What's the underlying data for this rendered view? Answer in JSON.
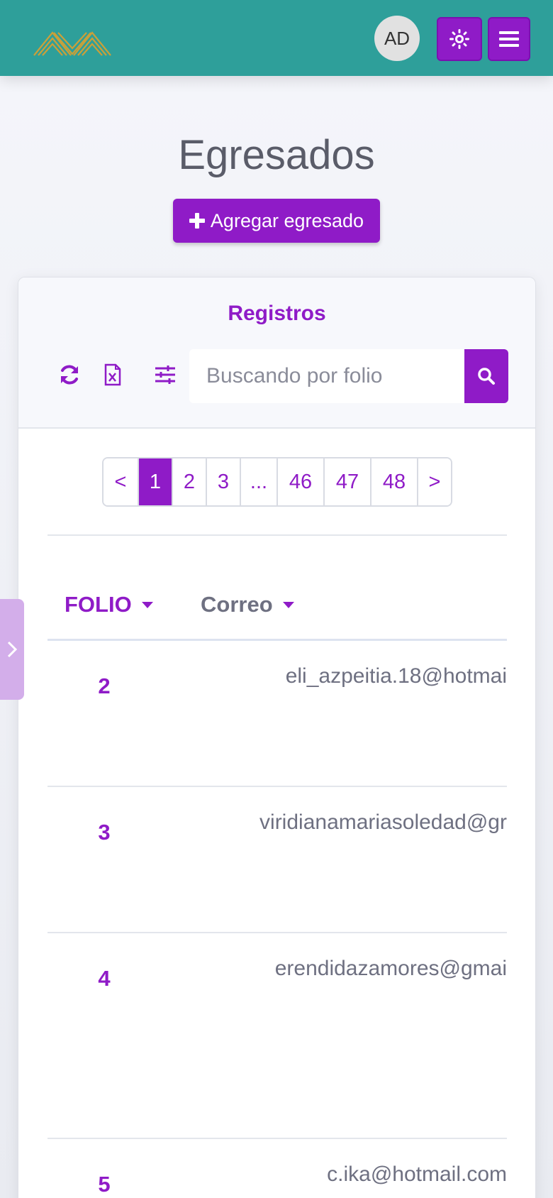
{
  "header": {
    "avatar_initials": "AD",
    "brand_color": "#2e9f9a",
    "accent_color": "#8f1bc7",
    "theme_icon": "sun-icon",
    "menu_icon": "hamburger-icon"
  },
  "page": {
    "title": "Egresados",
    "add_button_label": "Agregar egresado"
  },
  "card": {
    "title": "Registros",
    "tools": [
      "refresh-icon",
      "excel-file-icon",
      "filter-sliders-icon"
    ],
    "search": {
      "placeholder": "Buscando por folio",
      "value": ""
    }
  },
  "pagination": {
    "prev": "<",
    "pages": [
      "1",
      "2",
      "3",
      "...",
      "46",
      "47",
      "48"
    ],
    "active": "1",
    "next": ">"
  },
  "table": {
    "columns": [
      {
        "label": "FOLIO",
        "sortable": true
      },
      {
        "label": "Correo",
        "sortable": true
      }
    ],
    "rows": [
      {
        "folio": "2",
        "correo": "eli_azpeitia.18@hotmai"
      },
      {
        "folio": "3",
        "correo": "viridianamariasoledad@gr"
      },
      {
        "folio": "4",
        "correo": "erendidazamores@gmai"
      },
      {
        "folio": "5",
        "correo": "c.ika@hotmail.com"
      }
    ]
  }
}
